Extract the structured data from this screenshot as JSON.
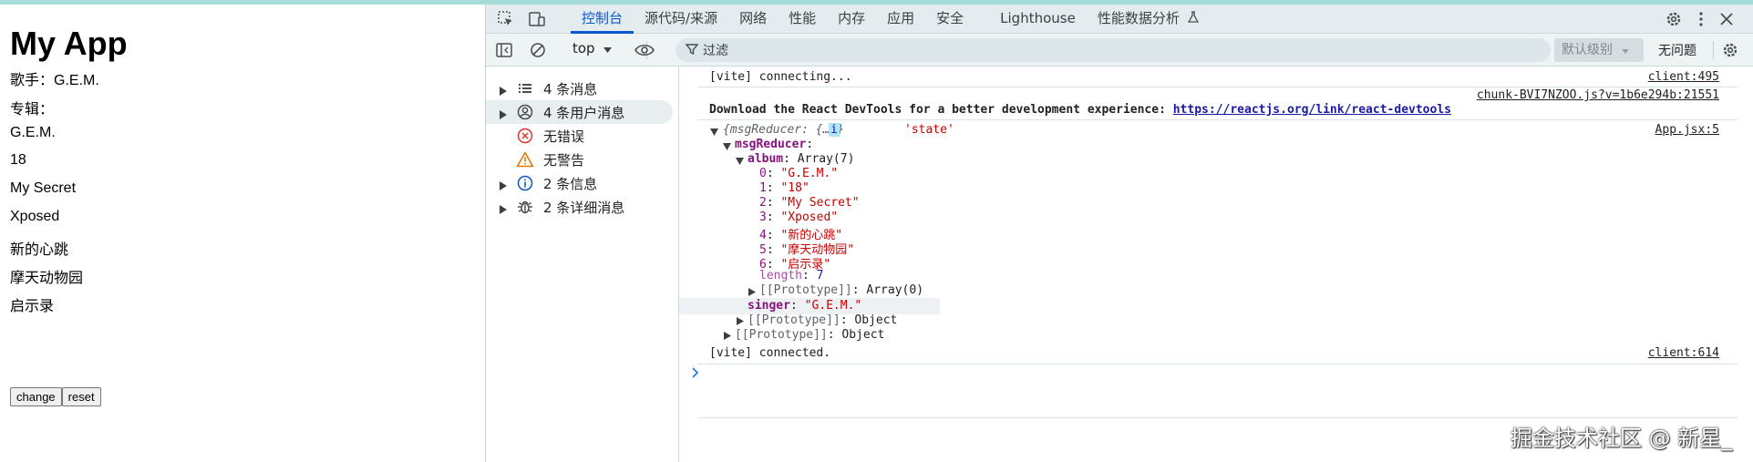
{
  "page": {
    "title": "My App",
    "singer_line": "歌手：G.E.M.",
    "album_label": "专辑：",
    "album": [
      "G.E.M.",
      "18",
      "My Secret",
      "Xposed",
      "新的心跳",
      "摩天动物园",
      "启示录"
    ],
    "buttons": {
      "change": "change",
      "reset": "reset"
    }
  },
  "devtools": {
    "tabs": [
      {
        "label": "控制台",
        "active": true
      },
      {
        "label": "源代码/来源"
      },
      {
        "label": "网络"
      },
      {
        "label": "性能"
      },
      {
        "label": "内存"
      },
      {
        "label": "应用"
      },
      {
        "label": "安全"
      },
      {
        "label": "Lighthouse"
      },
      {
        "label": "性能数据分析"
      }
    ],
    "context": "top",
    "filter_placeholder": "过滤",
    "level": "默认级别",
    "issues": "无问题",
    "sidebar": [
      {
        "label": "4 条消息",
        "icon": "list-icon"
      },
      {
        "label": "4 条用户消息",
        "icon": "user-icon"
      },
      {
        "label": "无错误",
        "icon": "error-icon"
      },
      {
        "label": "无警告",
        "icon": "warning-icon"
      },
      {
        "label": "2 条信息",
        "icon": "info-icon"
      },
      {
        "label": "2 条详细消息",
        "icon": "bug-icon"
      }
    ],
    "console": {
      "vite_connecting": "[vite] connecting...",
      "vite_connecting_src": "client:495",
      "react_src": "chunk-BVI7NZOO.js?v=1b6e294b:21551",
      "react_msg": "Download the React DevTools for a better development experience: ",
      "react_link": "https://reactjs.org/link/react-devtools",
      "log_preview": "{msgReducer: {…}}",
      "log_info_badge": "i",
      "log_state": "'state'",
      "log_src": "App.jsx:5",
      "msgReducer_key": "msgReducer",
      "album_key": "album",
      "album_type": "Array(7)",
      "album_entries": [
        {
          "idx": "0",
          "val": "\"G.E.M.\""
        },
        {
          "idx": "1",
          "val": "\"18\""
        },
        {
          "idx": "2",
          "val": "\"My Secret\""
        },
        {
          "idx": "3",
          "val": "\"Xposed\""
        },
        {
          "idx": "4",
          "val": "\"新的心跳\""
        },
        {
          "idx": "5",
          "val": "\"摩天动物园\""
        },
        {
          "idx": "6",
          "val": "\"启示录\""
        }
      ],
      "length_key": "length",
      "length_val": "7",
      "proto_key": "[[Prototype]]",
      "proto_array": "Array(0)",
      "singer_key": "singer",
      "singer_val": "\"G.E.M.\"",
      "proto_object": "Object",
      "vite_connected": "[vite] connected.",
      "vite_connected_src": "client:614"
    }
  },
  "watermark": "掘金技术社区 @ 新星_",
  "colors": {
    "accent": "#0b57d0",
    "key": "#881280",
    "string": "#c80000",
    "number": "#1a1aa6"
  }
}
